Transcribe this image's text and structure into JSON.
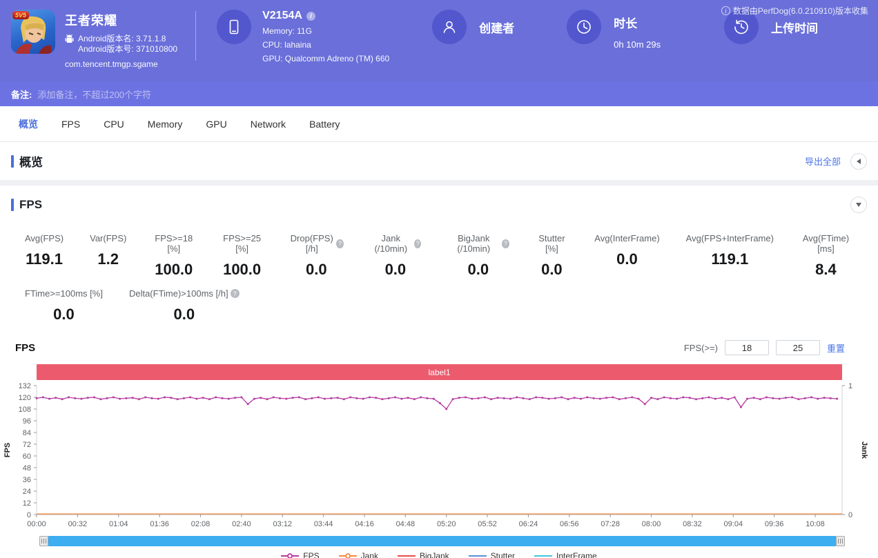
{
  "icons": {
    "info_glyph": "i",
    "help_glyph": "?"
  },
  "header": {
    "collect_note": "数据由PerfDog(6.0.210910)版本收集",
    "app": {
      "title": "王者荣耀",
      "icon_badge": "5V5",
      "android_version_name": "Android版本名: 3.71.1.8",
      "android_version_code": "Android版本号: 371010800",
      "package_name": "com.tencent.tmgp.sgame"
    },
    "device": {
      "model": "V2154A",
      "memory": "Memory: 11G",
      "cpu": "CPU: lahaina",
      "gpu": "GPU: Qualcomm Adreno (TM) 660"
    },
    "creator_label": "创建者",
    "duration_label": "时长",
    "duration_value": "0h 10m 29s",
    "upload_label": "上传时间"
  },
  "remark": {
    "label": "备注:",
    "placeholder": "添加备注，不超过200个字符"
  },
  "tabs": [
    {
      "label": "概览",
      "active": true
    },
    {
      "label": "FPS",
      "active": false
    },
    {
      "label": "CPU",
      "active": false
    },
    {
      "label": "Memory",
      "active": false
    },
    {
      "label": "GPU",
      "active": false
    },
    {
      "label": "Network",
      "active": false
    },
    {
      "label": "Battery",
      "active": false
    }
  ],
  "overview": {
    "title": "概览",
    "export_label": "导出全部"
  },
  "fps": {
    "title": "FPS",
    "chart_label": "FPS",
    "threshold_label": "FPS(>=)",
    "threshold_low": "18",
    "threshold_high": "25",
    "reset_label": "重置",
    "stats_row1": [
      {
        "label": "Avg(FPS)",
        "value": "119.1",
        "help": false
      },
      {
        "label": "Var(FPS)",
        "value": "1.2",
        "help": false
      },
      {
        "label": "FPS>=18 [%]",
        "value": "100.0",
        "help": false
      },
      {
        "label": "FPS>=25 [%]",
        "value": "100.0",
        "help": false
      },
      {
        "label": "Drop(FPS) [/h]",
        "value": "0.0",
        "help": true
      },
      {
        "label": "Jank (/10min)",
        "value": "0.0",
        "help": true
      },
      {
        "label": "BigJank (/10min)",
        "value": "0.0",
        "help": true
      },
      {
        "label": "Stutter [%]",
        "value": "0.0",
        "help": false
      },
      {
        "label": "Avg(InterFrame)",
        "value": "0.0",
        "help": false
      },
      {
        "label": "Avg(FPS+InterFrame)",
        "value": "119.1",
        "help": false
      },
      {
        "label": "Avg(FTime) [ms]",
        "value": "8.4",
        "help": false
      }
    ],
    "stats_row2": [
      {
        "label": "FTime>=100ms [%]",
        "value": "0.0",
        "help": false
      },
      {
        "label": "Delta(FTime)>100ms [/h]",
        "value": "0.0",
        "help": true
      }
    ]
  },
  "chart_data": {
    "type": "line",
    "title": "label1",
    "title_bg": "#ec5b6d",
    "ylabel": "FPS",
    "y2label": "Jank",
    "ylim": [
      0,
      132
    ],
    "y2lim": [
      0,
      1
    ],
    "yticks": [
      0,
      12,
      24,
      36,
      48,
      60,
      72,
      84,
      96,
      108,
      120,
      132
    ],
    "y2ticks": [
      0,
      1
    ],
    "duration_seconds": 629,
    "sample_interval_seconds": 5,
    "x_tick_interval_seconds": 32,
    "xticklabels": [
      "00:00",
      "00:32",
      "01:04",
      "01:36",
      "02:08",
      "02:40",
      "03:12",
      "03:44",
      "04:16",
      "04:48",
      "05:20",
      "05:52",
      "06:24",
      "06:56",
      "07:28",
      "08:00",
      "08:32",
      "09:04",
      "09:36",
      "10:08"
    ],
    "series": [
      {
        "name": "FPS",
        "color": "#b5399f",
        "axis": "left",
        "values": [
          119,
          120,
          118.5,
          119.5,
          118,
          120,
          119,
          118.5,
          119.5,
          120,
          118,
          119,
          120,
          118.5,
          119,
          119.5,
          118,
          120,
          119,
          118.5,
          120,
          119.5,
          118,
          119,
          120,
          118.5,
          119.5,
          118,
          120,
          119,
          118.5,
          119.5,
          120,
          113,
          118.5,
          119.5,
          118,
          120,
          119,
          118.5,
          119.5,
          120,
          118,
          119,
          120,
          118.5,
          119,
          119.5,
          118,
          120,
          119,
          118.5,
          120,
          119.5,
          118,
          119,
          120,
          118.5,
          119.5,
          118,
          120,
          119,
          118.5,
          114,
          108,
          118,
          119.5,
          120,
          118.5,
          119,
          120,
          118,
          119.5,
          119,
          118.5,
          120,
          119,
          118,
          120,
          119.5,
          118.5,
          119,
          120,
          118,
          119.5,
          118.5,
          120,
          119,
          118.5,
          119.5,
          120,
          118,
          119,
          120,
          118.5,
          113,
          119.5,
          118,
          120,
          119,
          118.5,
          120,
          119.5,
          118,
          119,
          120,
          118.5,
          119.5,
          118,
          120,
          110,
          118.5,
          119.5,
          118,
          120,
          119,
          118.5,
          119.5,
          120,
          118,
          119,
          120,
          118.5,
          119.5,
          119,
          118.5
        ]
      },
      {
        "name": "Jank",
        "color": "#f5893b",
        "axis": "right",
        "constant": 0
      },
      {
        "name": "BigJank",
        "color": "#e84c4c",
        "axis": "right",
        "constant": 0
      },
      {
        "name": "Stutter",
        "color": "#5b8fd8",
        "axis": "left",
        "constant": 0
      },
      {
        "name": "InterFrame",
        "color": "#3ec6d8",
        "axis": "left",
        "constant": 0
      }
    ],
    "legend": [
      {
        "name": "FPS",
        "color": "#b5399f",
        "marker": "circle"
      },
      {
        "name": "Jank",
        "color": "#f5893b",
        "marker": "circle"
      },
      {
        "name": "BigJank",
        "color": "#e84c4c",
        "marker": "line"
      },
      {
        "name": "Stutter",
        "color": "#5b8fd8",
        "marker": "line"
      },
      {
        "name": "InterFrame",
        "color": "#3ec6d8",
        "marker": "line"
      }
    ],
    "slider_color": "#3daef0"
  }
}
